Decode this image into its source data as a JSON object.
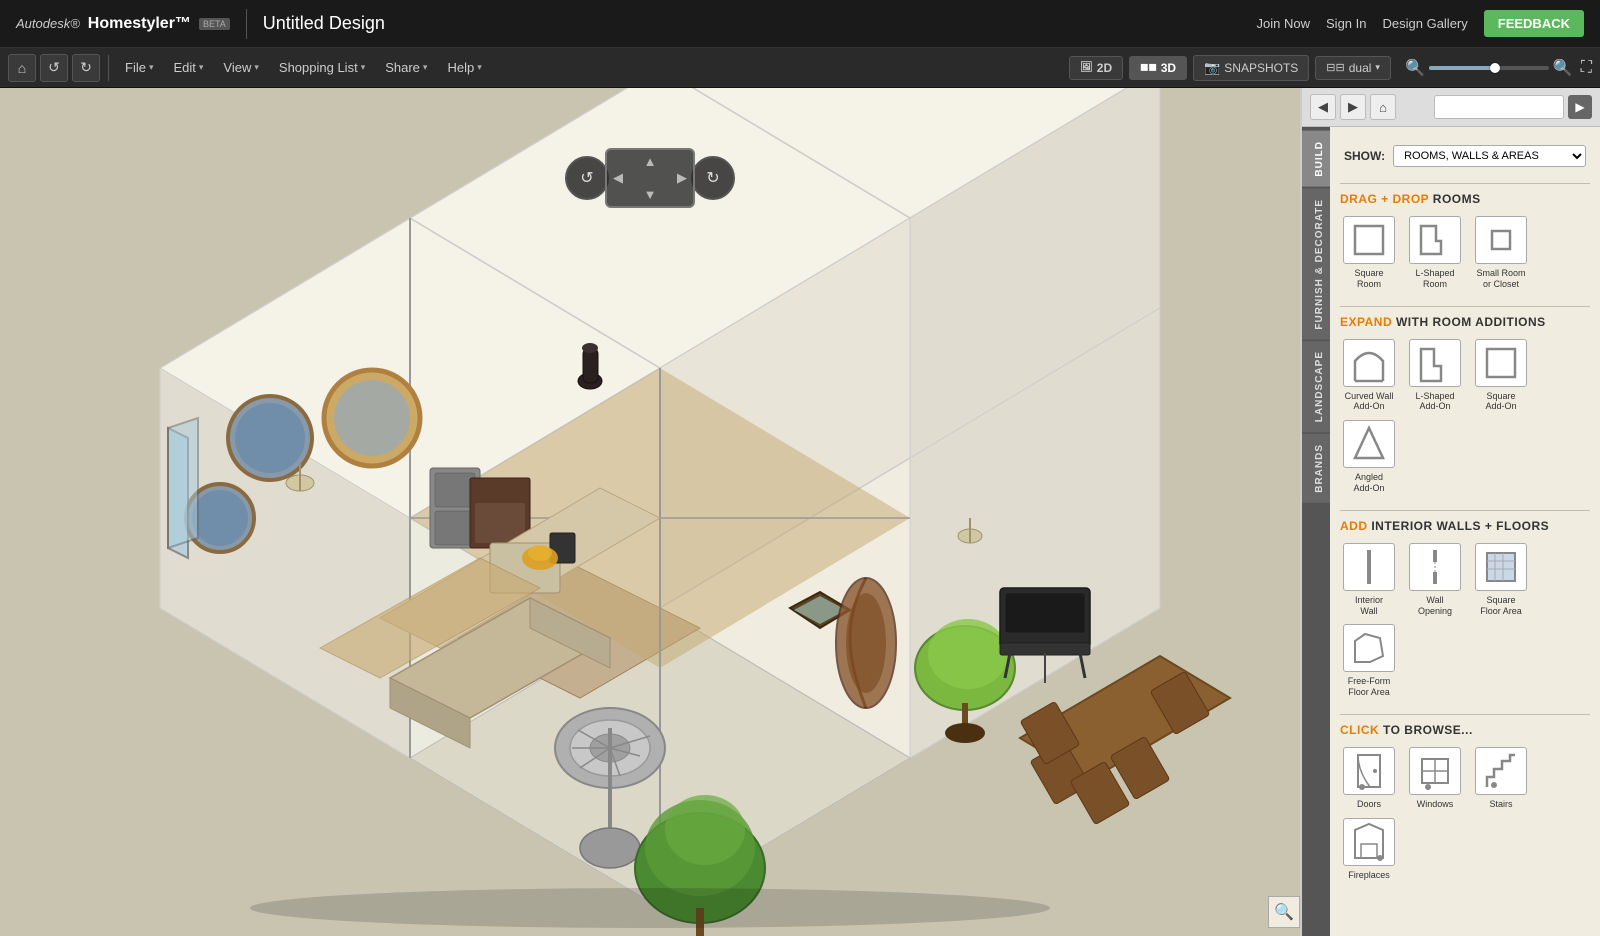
{
  "app": {
    "brand": "Autodesk® Homestyler™",
    "brand_autodesk": "Autodesk®",
    "brand_homestyler": "Homestyler™",
    "beta": "BETA",
    "title": "Untitled Design"
  },
  "top_nav": {
    "join_now": "Join Now",
    "sign_in": "Sign In",
    "design_gallery": "Design Gallery",
    "feedback": "FEEDBACK"
  },
  "toolbar": {
    "home_icon": "⌂",
    "undo_icon": "↺",
    "redo_icon": "↻",
    "file_label": "File",
    "edit_label": "Edit",
    "view_label": "View",
    "shopping_list_label": "Shopping List",
    "share_label": "Share",
    "help_label": "Help",
    "view_2d": "2D",
    "view_3d": "3D",
    "snapshots": "SNAPSHOTS",
    "dual": "dual"
  },
  "panel": {
    "build_label": "BUILD",
    "furnish_label": "FURNISH & DECORATE",
    "landscape_label": "LANDSCAPE",
    "brands_label": "BRANDS",
    "show_label": "SHOW:",
    "show_value": "ROOMS, WALLS & AREAS",
    "search_placeholder": "",
    "sections": {
      "drag_drop_rooms": {
        "prefix": "DRAG + DROP",
        "suffix": "ROOMS",
        "items": [
          {
            "label": "Square\nRoom",
            "id": "square-room"
          },
          {
            "label": "L-Shaped\nRoom",
            "id": "l-shaped-room"
          },
          {
            "label": "Small Room\nor Closet",
            "id": "small-room"
          }
        ]
      },
      "expand_rooms": {
        "prefix": "EXPAND",
        "suffix": "WITH ROOM ADDITIONS",
        "items": [
          {
            "label": "Curved Wall\nAdd-On",
            "id": "curved-wall"
          },
          {
            "label": "L-Shaped\nAdd-On",
            "id": "l-shaped-addon"
          },
          {
            "label": "Square\nAdd-On",
            "id": "square-addon"
          },
          {
            "label": "Angled\nAdd-On",
            "id": "angled-addon"
          }
        ]
      },
      "interior_walls": {
        "prefix": "ADD",
        "suffix": "INTERIOR WALLS + FLOORS",
        "items": [
          {
            "label": "Interior\nWall",
            "id": "interior-wall"
          },
          {
            "label": "Wall\nOpening",
            "id": "wall-opening"
          },
          {
            "label": "Square\nFloor Area",
            "id": "square-floor"
          },
          {
            "label": "Free-Form\nFloor Area",
            "id": "freeform-floor"
          }
        ]
      },
      "click_browse": {
        "prefix": "CLICK",
        "suffix": "TO BROWSE...",
        "items": [
          {
            "label": "Doors",
            "id": "doors"
          },
          {
            "label": "Windows",
            "id": "windows"
          },
          {
            "label": "Stairs",
            "id": "stairs"
          },
          {
            "label": "Fireplaces",
            "id": "fireplaces"
          }
        ]
      }
    }
  },
  "colors": {
    "accent_orange": "#e87c00",
    "toolbar_bg": "#2a2a2a",
    "panel_bg": "#f0ede0",
    "top_bar_bg": "#1a1a1a",
    "feedback_green": "#5cb85c",
    "active_3d_bg": "#555"
  }
}
